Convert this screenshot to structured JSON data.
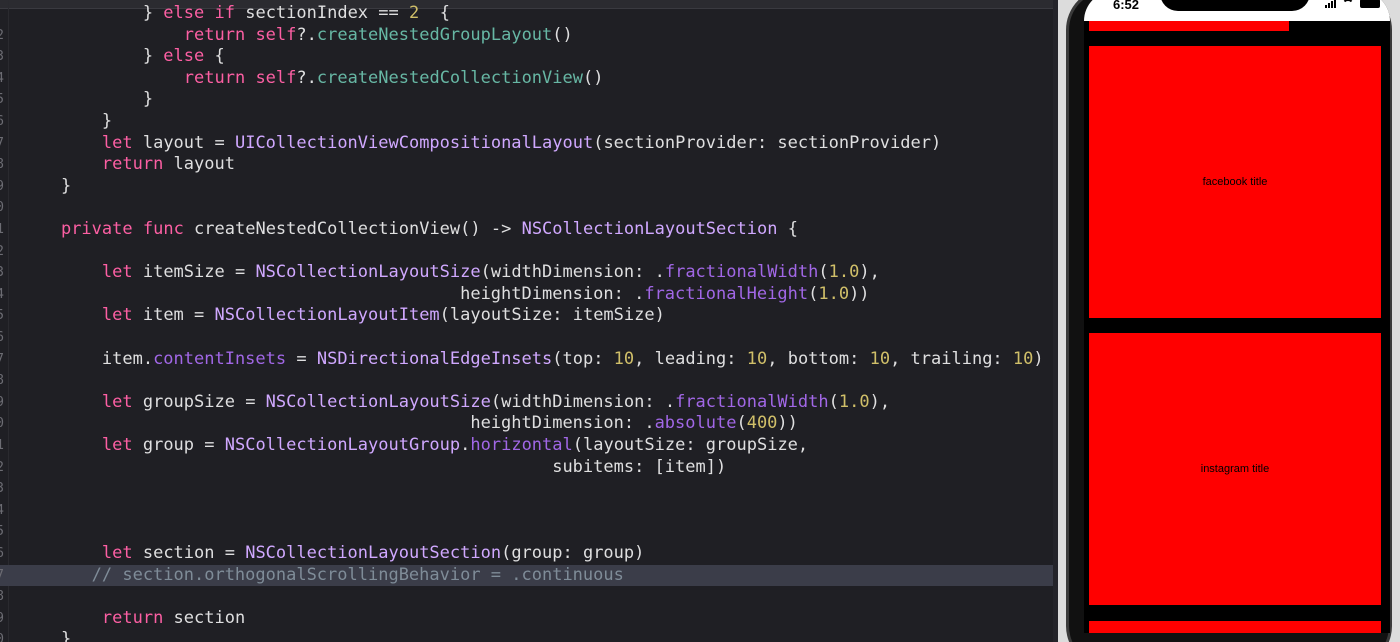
{
  "editor": {
    "lines": [
      {
        "ln": "",
        "tokens": [
          [
            "            } ",
            "t-tx"
          ],
          [
            "else",
            "t-kw"
          ],
          [
            " ",
            "t-tx"
          ],
          [
            "if",
            "t-kw"
          ],
          [
            " sectionIndex == ",
            "t-tx"
          ],
          [
            "2",
            "t-num"
          ],
          [
            "  {",
            "t-tx"
          ]
        ]
      },
      {
        "ln": "2",
        "tokens": [
          [
            "                ",
            "t-tx"
          ],
          [
            "return",
            "t-kw"
          ],
          [
            " ",
            "t-tx"
          ],
          [
            "self",
            "t-kw"
          ],
          [
            "?.",
            "t-tx"
          ],
          [
            "createNestedGroupLayout",
            "t-fn"
          ],
          [
            "()",
            "t-tx"
          ]
        ]
      },
      {
        "ln": "3",
        "tokens": [
          [
            "            } ",
            "t-tx"
          ],
          [
            "else",
            "t-kw"
          ],
          [
            " {",
            "t-tx"
          ]
        ]
      },
      {
        "ln": "4",
        "tokens": [
          [
            "                ",
            "t-tx"
          ],
          [
            "return",
            "t-kw"
          ],
          [
            " ",
            "t-tx"
          ],
          [
            "self",
            "t-kw"
          ],
          [
            "?.",
            "t-tx"
          ],
          [
            "createNestedCollectionView",
            "t-fn"
          ],
          [
            "()",
            "t-tx"
          ]
        ]
      },
      {
        "ln": "5",
        "tokens": [
          [
            "            }",
            "t-tx"
          ]
        ]
      },
      {
        "ln": "6",
        "tokens": [
          [
            "        }",
            "t-tx"
          ]
        ]
      },
      {
        "ln": "7",
        "tokens": [
          [
            "        ",
            "t-tx"
          ],
          [
            "let",
            "t-kw"
          ],
          [
            " layout = ",
            "t-tx"
          ],
          [
            "UICollectionViewCompositionalLayout",
            "t-ty"
          ],
          [
            "(sectionProvider: sectionProvider)",
            "t-tx"
          ]
        ]
      },
      {
        "ln": "8",
        "tokens": [
          [
            "        ",
            "t-tx"
          ],
          [
            "return",
            "t-kw"
          ],
          [
            " layout",
            "t-tx"
          ]
        ]
      },
      {
        "ln": "9",
        "tokens": [
          [
            "    }",
            "t-tx"
          ]
        ]
      },
      {
        "ln": "0",
        "tokens": []
      },
      {
        "ln": "1",
        "tokens": [
          [
            "    ",
            "t-tx"
          ],
          [
            "private",
            "t-kw"
          ],
          [
            " ",
            "t-tx"
          ],
          [
            "func",
            "t-kw"
          ],
          [
            " createNestedCollectionView() -> ",
            "t-tx"
          ],
          [
            "NSCollectionLayoutSection",
            "t-ty"
          ],
          [
            " {",
            "t-tx"
          ]
        ]
      },
      {
        "ln": "2",
        "tokens": []
      },
      {
        "ln": "3",
        "tokens": [
          [
            "        ",
            "t-tx"
          ],
          [
            "let",
            "t-kw"
          ],
          [
            " itemSize = ",
            "t-tx"
          ],
          [
            "NSCollectionLayoutSize",
            "t-ty"
          ],
          [
            "(widthDimension: .",
            "t-tx"
          ],
          [
            "fractionalWidth",
            "t-mb"
          ],
          [
            "(",
            "t-tx"
          ],
          [
            "1.0",
            "t-num"
          ],
          [
            "),",
            "t-tx"
          ]
        ]
      },
      {
        "ln": "4",
        "tokens": [
          [
            "                                           heightDimension: .",
            "t-tx"
          ],
          [
            "fractionalHeight",
            "t-mb"
          ],
          [
            "(",
            "t-tx"
          ],
          [
            "1.0",
            "t-num"
          ],
          [
            "))",
            "t-tx"
          ]
        ]
      },
      {
        "ln": "5",
        "tokens": [
          [
            "        ",
            "t-tx"
          ],
          [
            "let",
            "t-kw"
          ],
          [
            " item = ",
            "t-tx"
          ],
          [
            "NSCollectionLayoutItem",
            "t-ty"
          ],
          [
            "(layoutSize: itemSize)",
            "t-tx"
          ]
        ]
      },
      {
        "ln": "6",
        "tokens": []
      },
      {
        "ln": "7",
        "tokens": [
          [
            "        item.",
            "t-tx"
          ],
          [
            "contentInsets",
            "t-mb"
          ],
          [
            " = ",
            "t-tx"
          ],
          [
            "NSDirectionalEdgeInsets",
            "t-ty"
          ],
          [
            "(top: ",
            "t-tx"
          ],
          [
            "10",
            "t-num"
          ],
          [
            ", leading: ",
            "t-tx"
          ],
          [
            "10",
            "t-num"
          ],
          [
            ", bottom: ",
            "t-tx"
          ],
          [
            "10",
            "t-num"
          ],
          [
            ", trailing: ",
            "t-tx"
          ],
          [
            "10",
            "t-num"
          ],
          [
            ")",
            "t-tx"
          ]
        ]
      },
      {
        "ln": "8",
        "tokens": []
      },
      {
        "ln": "9",
        "tokens": [
          [
            "        ",
            "t-tx"
          ],
          [
            "let",
            "t-kw"
          ],
          [
            " groupSize = ",
            "t-tx"
          ],
          [
            "NSCollectionLayoutSize",
            "t-ty"
          ],
          [
            "(widthDimension: .",
            "t-tx"
          ],
          [
            "fractionalWidth",
            "t-mb"
          ],
          [
            "(",
            "t-tx"
          ],
          [
            "1.0",
            "t-num"
          ],
          [
            "),",
            "t-tx"
          ]
        ]
      },
      {
        "ln": "0",
        "tokens": [
          [
            "                                            heightDimension: .",
            "t-tx"
          ],
          [
            "absolute",
            "t-mb"
          ],
          [
            "(",
            "t-tx"
          ],
          [
            "400",
            "t-num"
          ],
          [
            "))",
            "t-tx"
          ]
        ]
      },
      {
        "ln": "1",
        "tokens": [
          [
            "        ",
            "t-tx"
          ],
          [
            "let",
            "t-kw"
          ],
          [
            " group = ",
            "t-tx"
          ],
          [
            "NSCollectionLayoutGroup",
            "t-ty"
          ],
          [
            ".",
            "t-tx"
          ],
          [
            "horizontal",
            "t-mb"
          ],
          [
            "(layoutSize: groupSize,",
            "t-tx"
          ]
        ]
      },
      {
        "ln": "2",
        "tokens": [
          [
            "                                                    subitems: [item])",
            "t-tx"
          ]
        ]
      },
      {
        "ln": "3",
        "tokens": []
      },
      {
        "ln": "4",
        "tokens": []
      },
      {
        "ln": "5",
        "tokens": []
      },
      {
        "ln": "6",
        "tokens": [
          [
            "        ",
            "t-tx"
          ],
          [
            "let",
            "t-kw"
          ],
          [
            " section = ",
            "t-tx"
          ],
          [
            "NSCollectionLayoutSection",
            "t-ty"
          ],
          [
            "(group: group)",
            "t-tx"
          ]
        ]
      },
      {
        "ln": "7",
        "tokens": [
          [
            "       // section.orthogonalScrollingBehavior = .continuous",
            "t-cm"
          ]
        ],
        "highlight": true
      },
      {
        "ln": "8",
        "tokens": []
      },
      {
        "ln": "9",
        "tokens": [
          [
            "        ",
            "t-tx"
          ],
          [
            "return",
            "t-kw"
          ],
          [
            " section",
            "t-tx"
          ]
        ]
      },
      {
        "ln": "0",
        "tokens": [
          [
            "    }",
            "t-tx"
          ]
        ]
      }
    ]
  },
  "simulator": {
    "time": "6:52",
    "cells": [
      {
        "title": "facebook title"
      },
      {
        "title": "instagram title"
      }
    ],
    "colors": {
      "cell": "#ff0000",
      "screen_bg": "#000000"
    },
    "icons": [
      "cellular-signal-icon",
      "wifi-icon",
      "battery-icon"
    ]
  }
}
